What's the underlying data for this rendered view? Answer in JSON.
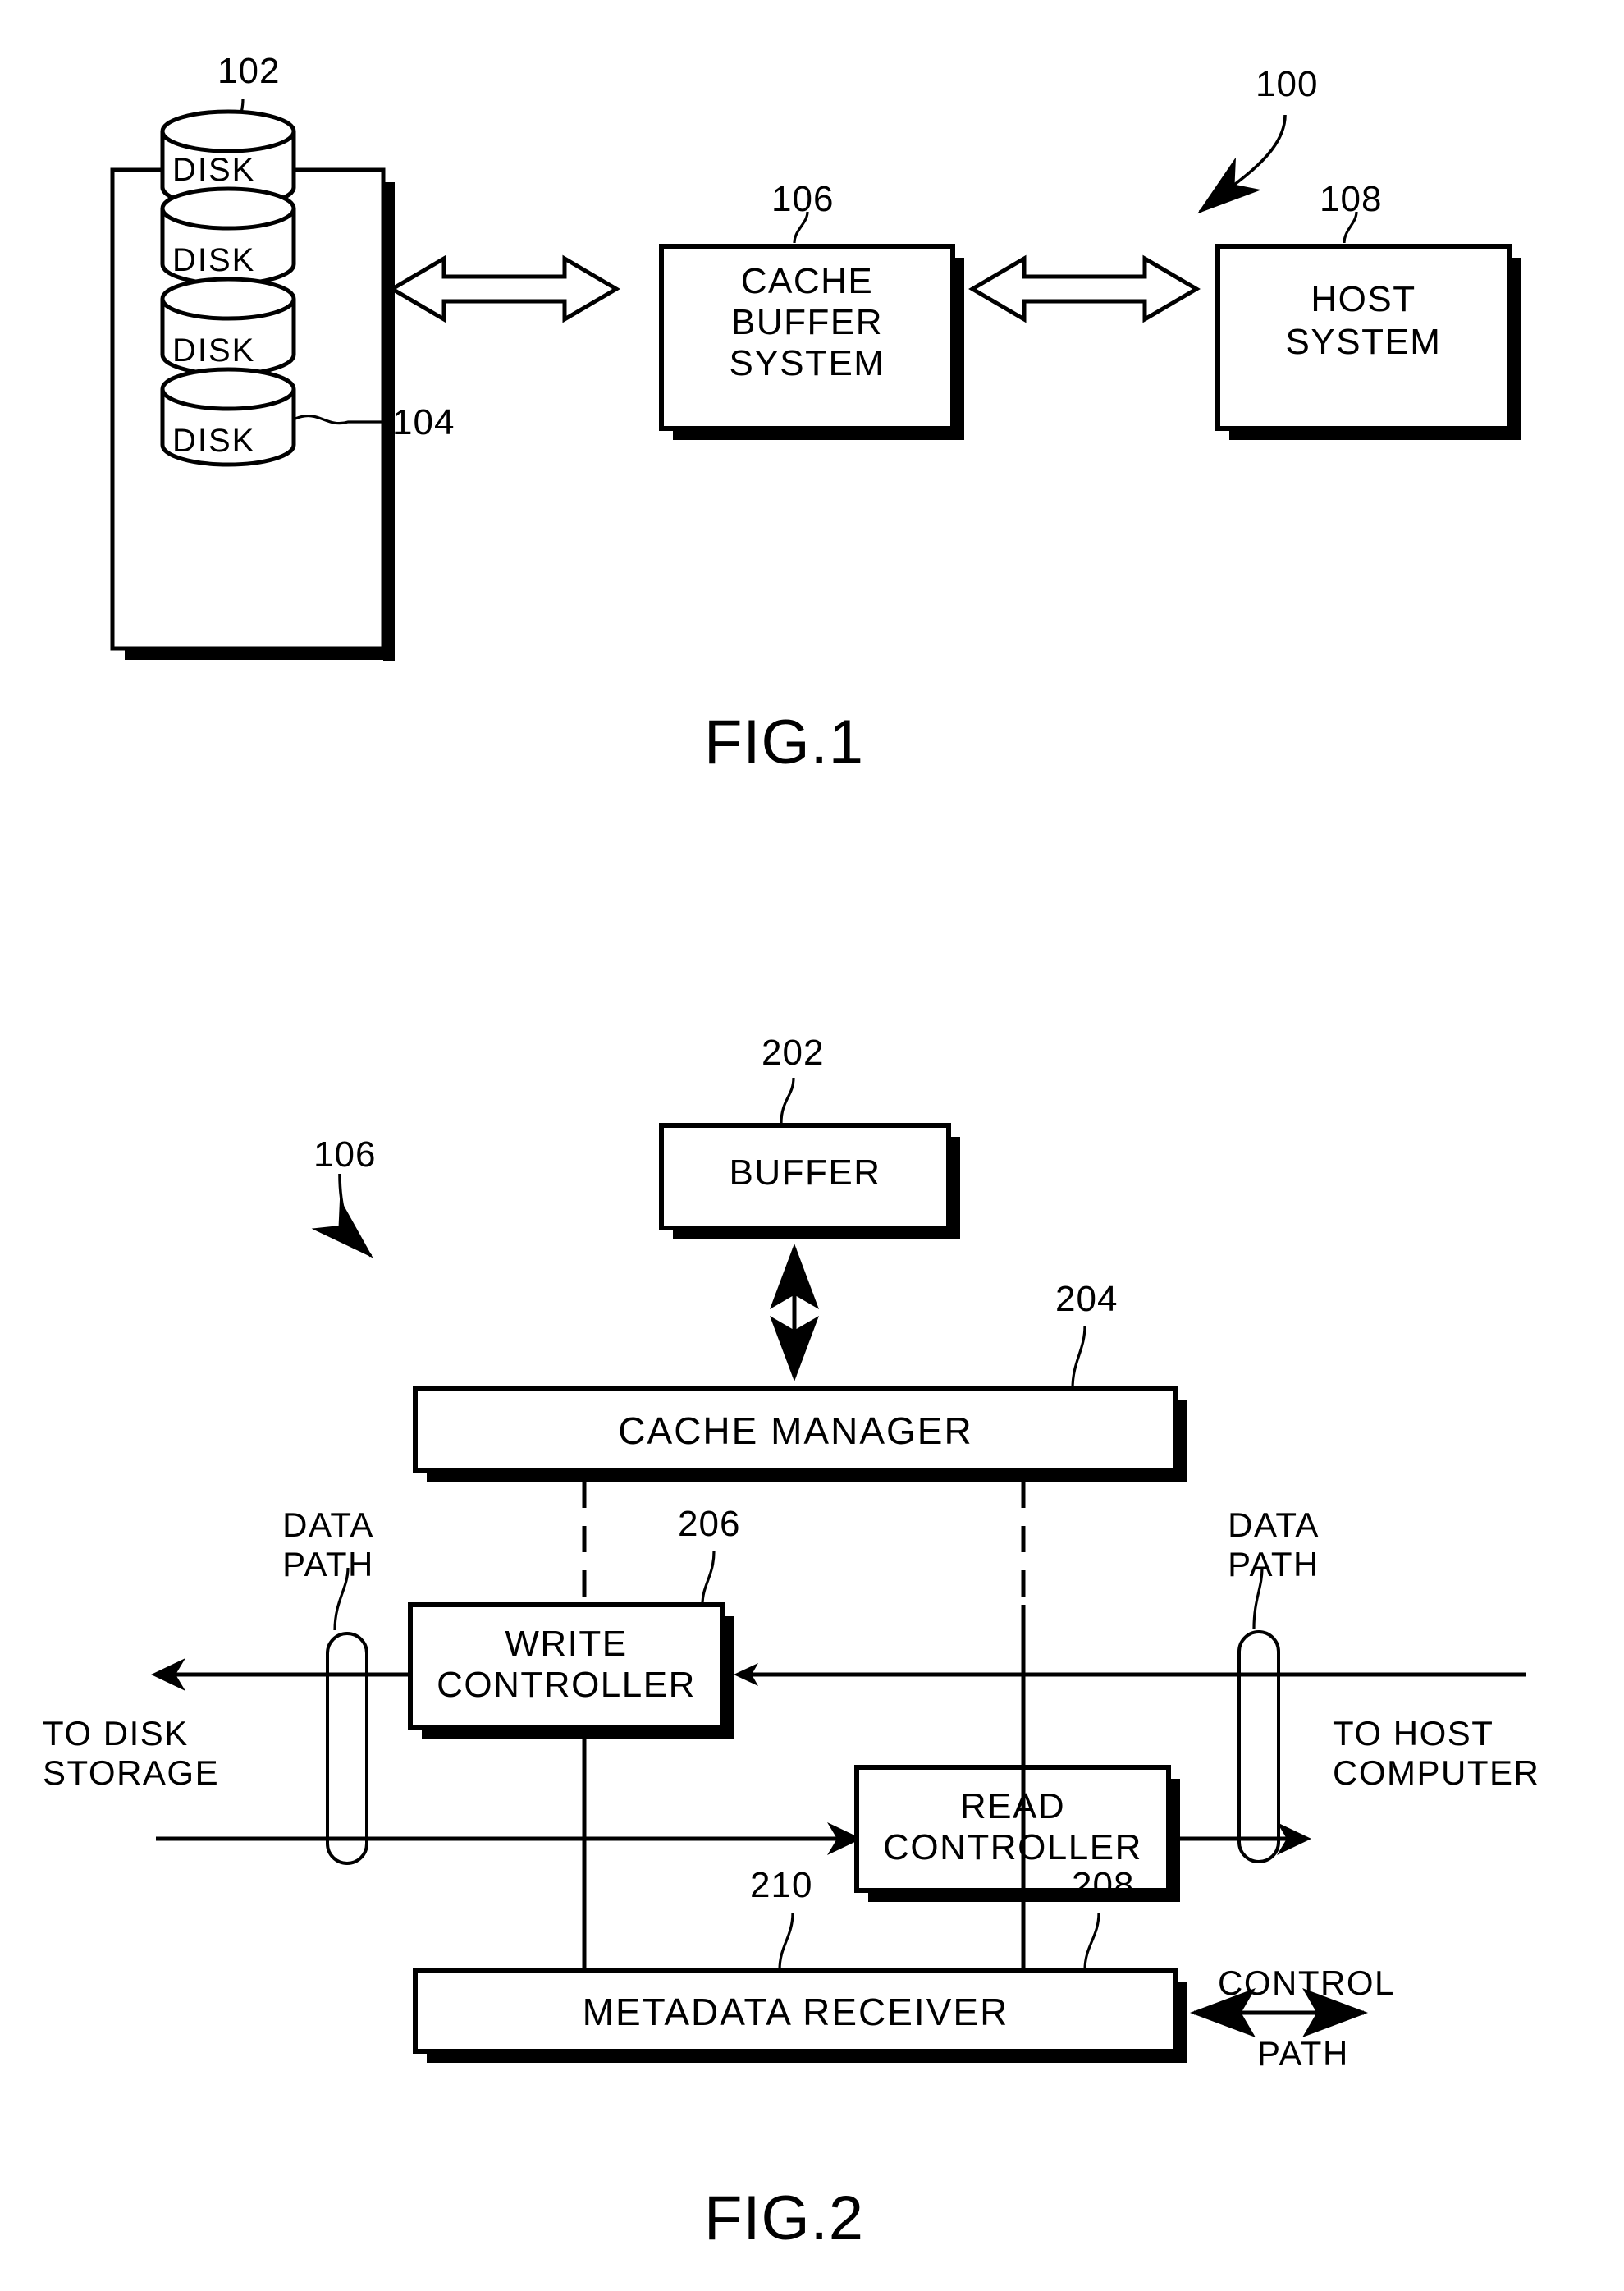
{
  "document": {
    "type": "patent-drawing-sheet",
    "figures": [
      "FIG.1",
      "FIG.2"
    ]
  },
  "fig1": {
    "title": "FIG.1",
    "system_ref": "100",
    "disk_array": {
      "ref": "102",
      "disk_ref": "104",
      "disks": [
        {
          "label": "DISK"
        },
        {
          "label": "DISK"
        },
        {
          "label": "DISK"
        },
        {
          "label": "DISK"
        }
      ]
    },
    "cache_buffer": {
      "ref": "106",
      "line1": "CACHE",
      "line2": "BUFFER",
      "line3": "SYSTEM"
    },
    "host": {
      "ref": "108",
      "line1": "HOST",
      "line2": "SYSTEM"
    }
  },
  "fig2": {
    "title": "FIG.2",
    "system_ref": "106",
    "buffer": {
      "ref": "202",
      "label": "BUFFER"
    },
    "cache_manager": {
      "ref": "204",
      "label": "CACHE MANAGER"
    },
    "write_controller": {
      "ref": "206",
      "line1": "WRITE",
      "line2": "CONTROLLER"
    },
    "read_controller": {
      "ref": "208",
      "line1": "READ",
      "line2": "CONTROLLER"
    },
    "metadata_receiver": {
      "ref": "210",
      "label": "METADATA RECEIVER"
    },
    "left_data_path": {
      "line1": "DATA",
      "line2": "PATH"
    },
    "right_data_path": {
      "line1": "DATA",
      "line2": "PATH"
    },
    "to_disk_storage": {
      "line1": "TO DISK",
      "line2": "STORAGE"
    },
    "to_host_computer": {
      "line1": "TO HOST",
      "line2": "COMPUTER"
    },
    "control_path": {
      "line1": "CONTROL",
      "line2": "PATH"
    }
  },
  "colors": {
    "ink": "#000000",
    "paper": "#ffffff"
  }
}
